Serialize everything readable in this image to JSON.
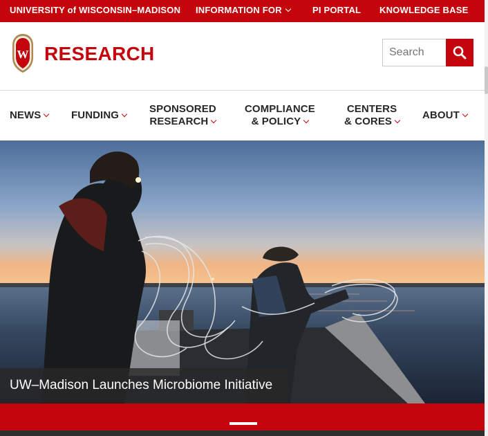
{
  "topbar": {
    "university": "UNIVERSITY of WISCONSIN–MADISON",
    "info_for": "INFORMATION FOR",
    "pi_portal": "PI PORTAL",
    "knowledge_base": "KNOWLEDGE BASE",
    "color": "#c5050c"
  },
  "header": {
    "crest_letter": "W",
    "brand": "RESEARCH",
    "search_placeholder": "Search"
  },
  "nav": {
    "news": "NEWS",
    "funding": "FUNDING",
    "sponsored_1": "SPONSORED",
    "sponsored_2": "RESEARCH",
    "compliance_1": "COMPLIANCE",
    "compliance_2": "& POLICY",
    "centers_1": "CENTERS",
    "centers_2": "& CORES",
    "about": "ABOUT"
  },
  "hero": {
    "caption": "UW–Madison Launches Microbiome Initiative"
  },
  "icons": {
    "crest": "uw-crest-icon",
    "search": "search-icon",
    "chevron": "chevron-down-icon"
  }
}
